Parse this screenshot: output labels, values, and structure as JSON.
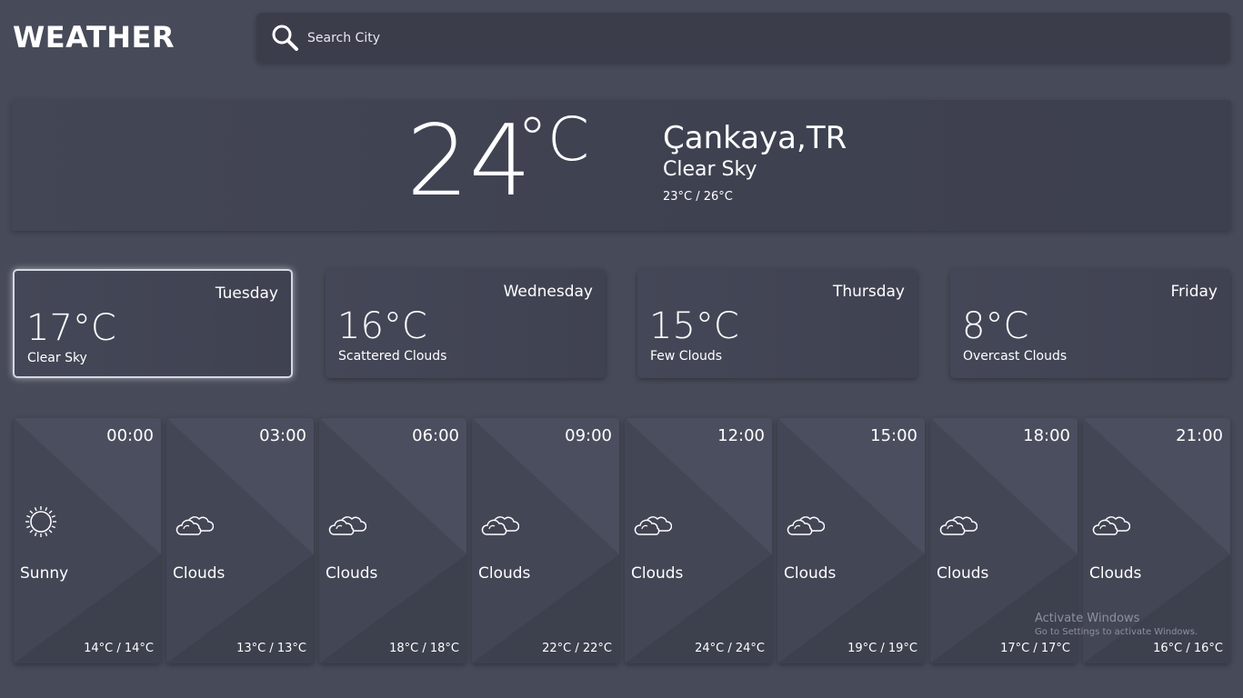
{
  "app": {
    "title": "WEATHER"
  },
  "search": {
    "placeholder": "Search City",
    "value": ""
  },
  "current": {
    "temperature": "24",
    "unit": "°C",
    "location": "Çankaya,TR",
    "condition": "Clear Sky",
    "range": "23°C / 26°C"
  },
  "days": [
    {
      "name": "Tuesday",
      "temp": "17°C",
      "condition": "Clear Sky",
      "selected": true
    },
    {
      "name": "Wednesday",
      "temp": "16°C",
      "condition": "Scattered Clouds",
      "selected": false
    },
    {
      "name": "Thursday",
      "temp": "15°C",
      "condition": "Few Clouds",
      "selected": false
    },
    {
      "name": "Friday",
      "temp": "8°C",
      "condition": "Overcast Clouds",
      "selected": false
    }
  ],
  "hours": [
    {
      "time": "00:00",
      "condition": "Sunny",
      "icon": "sun-icon",
      "range": "14°C / 14°C"
    },
    {
      "time": "03:00",
      "condition": "Clouds",
      "icon": "clouds-icon",
      "range": "13°C / 13°C"
    },
    {
      "time": "06:00",
      "condition": "Clouds",
      "icon": "clouds-icon",
      "range": "18°C / 18°C"
    },
    {
      "time": "09:00",
      "condition": "Clouds",
      "icon": "clouds-icon",
      "range": "22°C / 22°C"
    },
    {
      "time": "12:00",
      "condition": "Clouds",
      "icon": "clouds-icon",
      "range": "24°C / 24°C"
    },
    {
      "time": "15:00",
      "condition": "Clouds",
      "icon": "clouds-icon",
      "range": "19°C / 19°C"
    },
    {
      "time": "18:00",
      "condition": "Clouds",
      "icon": "clouds-icon",
      "range": "17°C / 17°C"
    },
    {
      "time": "21:00",
      "condition": "Clouds",
      "icon": "clouds-icon",
      "range": "16°C / 16°C"
    }
  ],
  "watermark": {
    "title": "Activate Windows",
    "subtitle": "Go to Settings to activate Windows."
  },
  "colors": {
    "background": "#474a59",
    "panel": "#3e4150",
    "search_bg": "#3b3d4b",
    "text": "#ffffff"
  }
}
